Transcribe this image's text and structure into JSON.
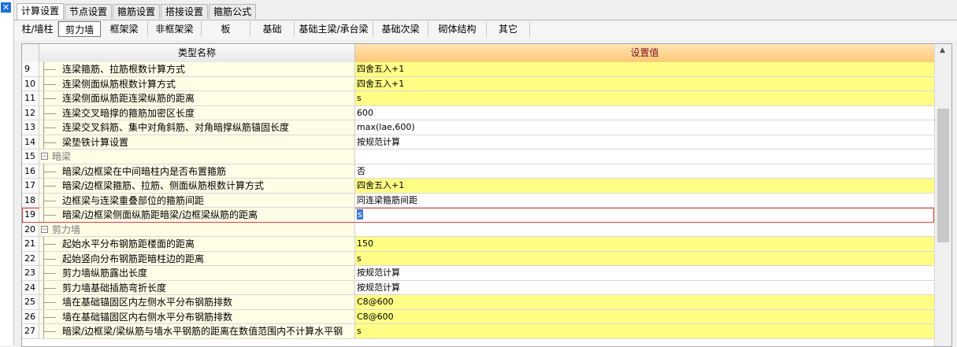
{
  "main_tabs": [
    "计算设置",
    "节点设置",
    "箍筋设置",
    "搭接设置",
    "箍筋公式"
  ],
  "sub_tabs": [
    "柱/墙柱",
    "剪力墙",
    "框架梁",
    "非框架梁",
    "板",
    "基础",
    "基础主梁/承台梁",
    "基础次梁",
    "砌体结构",
    "其它"
  ],
  "grid": {
    "col_name": "类型名称",
    "col_value": "设置值",
    "rows": [
      {
        "n": "9",
        "name": "连梁箍筋、拉筋根数计算方式",
        "value": "四舍五入+1",
        "vc": "yellow"
      },
      {
        "n": "10",
        "name": "连梁侧面纵筋根数计算方式",
        "value": "四舍五入+1",
        "vc": "yellow"
      },
      {
        "n": "11",
        "name": "连梁侧面纵筋距连梁纵筋的距离",
        "value": "s",
        "vc": "yellow"
      },
      {
        "n": "12",
        "name": "连梁交叉暗撑的箍筋加密区长度",
        "value": "600",
        "vc": "white"
      },
      {
        "n": "13",
        "name": "连梁交叉斜筋、集中对角斜筋、对角暗撑纵筋锚固长度",
        "value": "max(lae,600)",
        "vc": "white"
      },
      {
        "n": "14",
        "name": "梁垫铁计算设置",
        "value": "按规范计算",
        "vc": "white"
      },
      {
        "n": "15",
        "name": "暗梁",
        "value": "",
        "vc": "white",
        "group": true
      },
      {
        "n": "16",
        "name": "暗梁/边框梁在中间暗柱内是否布置箍筋",
        "value": "否",
        "vc": "white"
      },
      {
        "n": "17",
        "name": "暗梁/边框梁箍筋、拉筋、侧面纵筋根数计算方式",
        "value": "四舍五入+1",
        "vc": "yellow"
      },
      {
        "n": "18",
        "name": "边框梁与连梁重叠部位的箍筋间距",
        "value": "同连梁箍筋间距",
        "vc": "white"
      },
      {
        "n": "19",
        "name": "暗梁/边框梁侧面纵筋距暗梁/边框梁纵筋的距离",
        "value": "s",
        "vc": "white",
        "selected": true
      },
      {
        "n": "20",
        "name": "剪力墙",
        "value": "",
        "vc": "white",
        "group": true
      },
      {
        "n": "21",
        "name": "起始水平分布钢筋距楼面的距离",
        "value": "150",
        "vc": "yellow"
      },
      {
        "n": "22",
        "name": "起始竖向分布钢筋距暗柱边的距离",
        "value": "s",
        "vc": "yellow"
      },
      {
        "n": "23",
        "name": "剪力墙纵筋露出长度",
        "value": "按规范计算",
        "vc": "white"
      },
      {
        "n": "24",
        "name": "剪力墙基础插筋弯折长度",
        "value": "按规范计算",
        "vc": "white"
      },
      {
        "n": "25",
        "name": "墙在基础锚固区内左侧水平分布钢筋排数",
        "value": "C8@600",
        "vc": "yellow"
      },
      {
        "n": "26",
        "name": "墙在基础锚固区内右侧水平分布钢筋排数",
        "value": "C8@600",
        "vc": "yellow"
      },
      {
        "n": "27",
        "name": "暗梁/边框梁/梁纵筋与墙水平钢筋的距离在数值范围内不计算水平钢",
        "value": "s",
        "vc": "yellow"
      }
    ]
  },
  "icons": {
    "close": "close-icon",
    "collapse": "minus-icon",
    "scroll_up": "chevron-up-icon"
  }
}
